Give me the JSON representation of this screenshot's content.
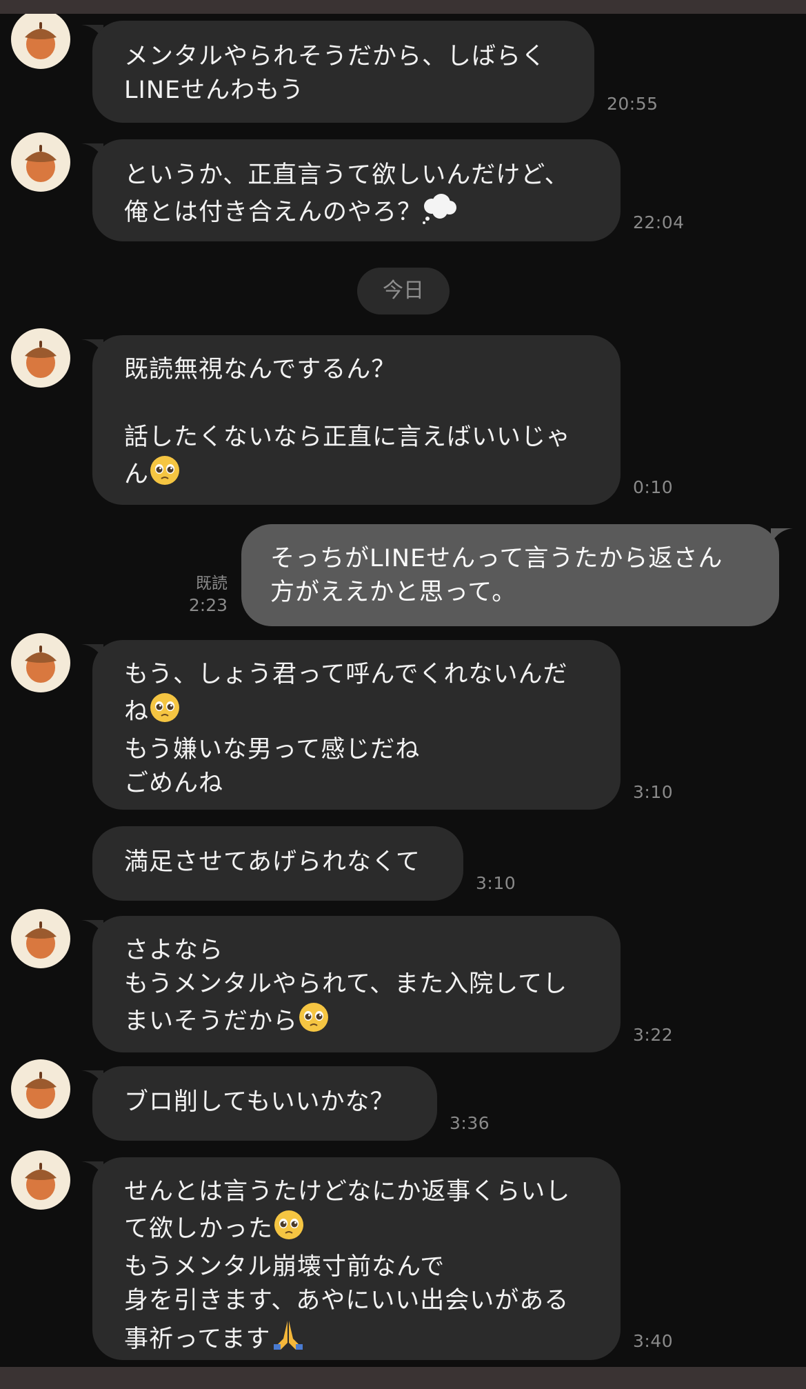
{
  "date_divider": "今日",
  "messages": [
    {
      "text": "メンタルやられそうだから、しばらく\nLINEせんわもう",
      "time": "20:55"
    },
    {
      "text": "というか、正直言うて欲しいんだけど、\n俺とは付き合えんのやろ？",
      "time": "22:04"
    },
    {
      "text": "既読無視なんでするん？\n\n話したくないなら正直に言えばいいじゃ\nん",
      "time": "0:10"
    },
    {
      "text": "そっちがLINEせんって言うたから返さん\n方がええかと思って。",
      "time": "2:23",
      "read": "既読"
    },
    {
      "text": "もう、しょう君って呼んでくれないんだ\nね",
      "text2": "\nもう嫌いな男って感じだね\nごめんね",
      "time": "3:10"
    },
    {
      "text": "満足させてあげられなくて",
      "time": "3:10"
    },
    {
      "text": "さよなら\nもうメンタルやられて、また入院してし\nまいそうだから",
      "time": "3:22"
    },
    {
      "text": "ブロ削してもいいかな？",
      "time": "3:36"
    },
    {
      "text": "せんとは言うたけどなにか返事くらいし\nて欲しかった",
      "text2": "\nもうメンタル崩壊寸前なんで\n身を引きます、あやにいい出会いがある\n事祈ってます",
      "time": "3:40"
    }
  ],
  "icons": {
    "avatar": "acorn-icon",
    "thought": "thought-balloon-emoji",
    "pleading": "pleading-face-emoji",
    "pray": "folded-hands-emoji"
  },
  "colors": {
    "background": "#0e0e0e",
    "bubble_in": "#2b2b2b",
    "bubble_out": "#5a5a5a",
    "timestamp": "#8a8a8a",
    "acorn_cap": "#9b5a2e",
    "acorn_body": "#d9783f"
  }
}
